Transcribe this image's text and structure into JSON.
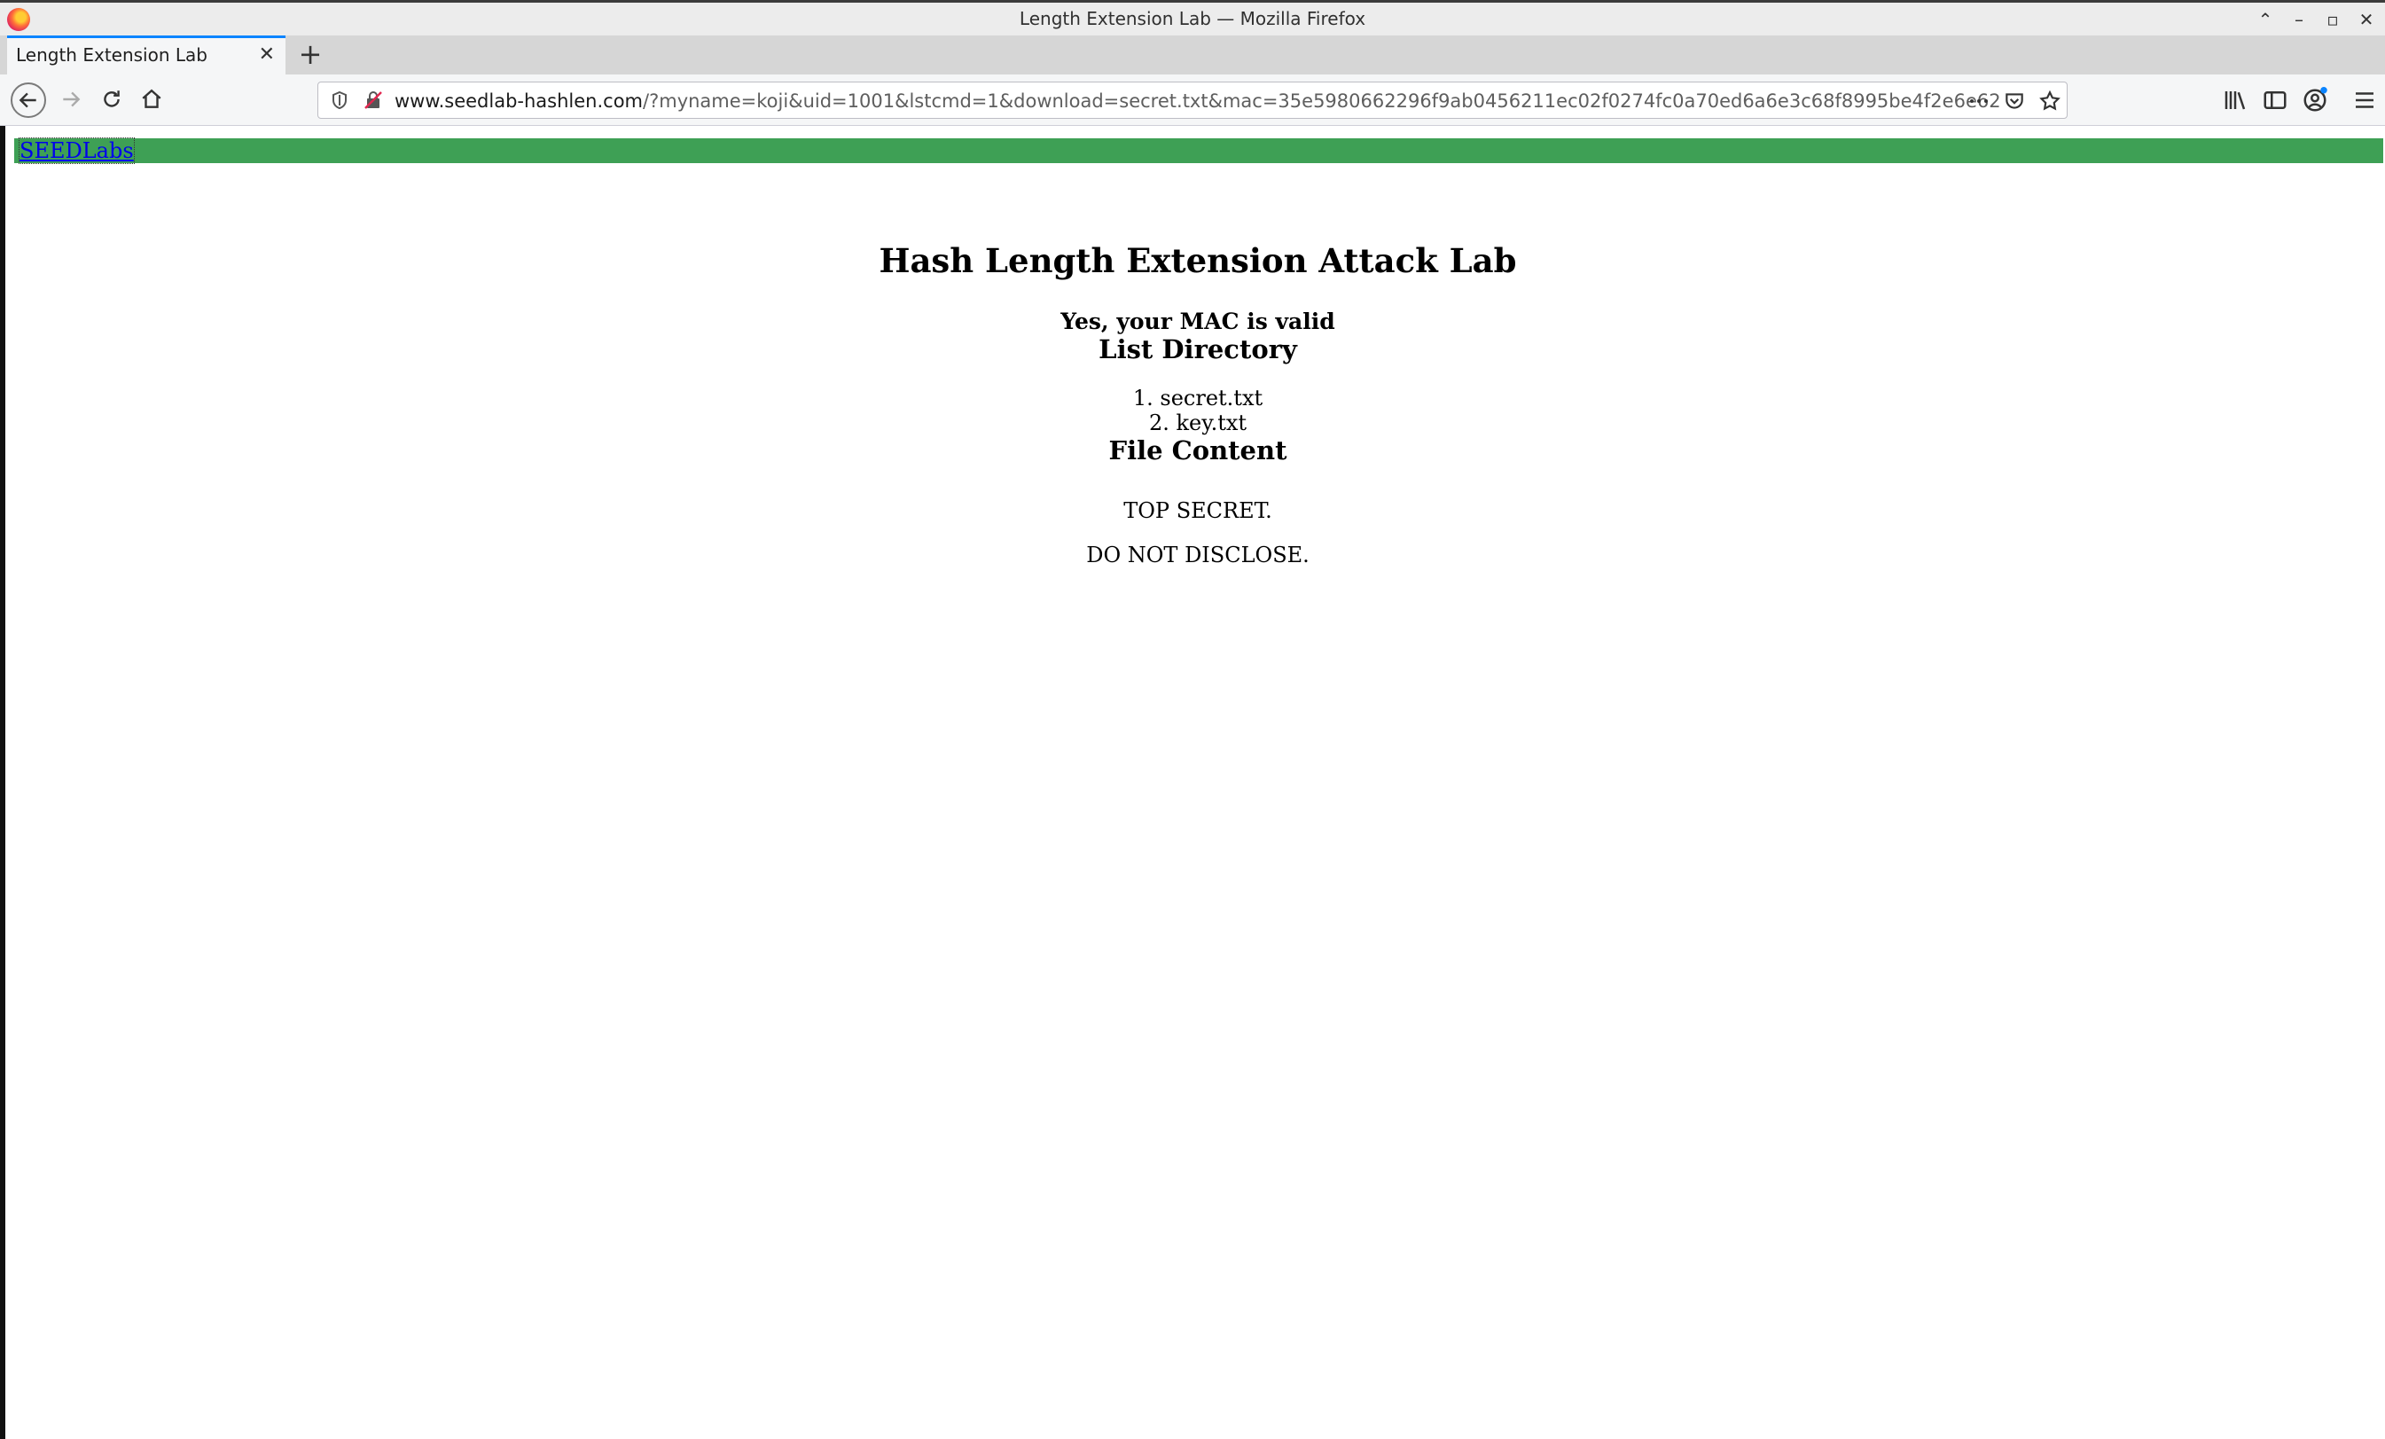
{
  "window": {
    "title": "Length Extension Lab — Mozilla Firefox"
  },
  "tabs": [
    {
      "label": "Length Extension Lab"
    }
  ],
  "navbar": {
    "url_host": "www.seedlab-hashlen.com",
    "url_path": "/?myname=koji&uid=1001&lstcmd=1&download=secret.txt&mac=35e5980662296f9ab0456211ec02f0274fc0a70ed6a6e3c68f8995be4f2e6e62"
  },
  "page": {
    "nav_link": "SEEDLabs",
    "nav_bar_color": "#3ea055",
    "heading": "Hash Length Extension Attack Lab",
    "status": "Yes, your MAC is valid",
    "list_heading": "List Directory",
    "files": [
      "secret.txt",
      "key.txt"
    ],
    "file_heading": "File Content",
    "file_lines": [
      "TOP SECRET.",
      "DO NOT DISCLOSE."
    ]
  }
}
